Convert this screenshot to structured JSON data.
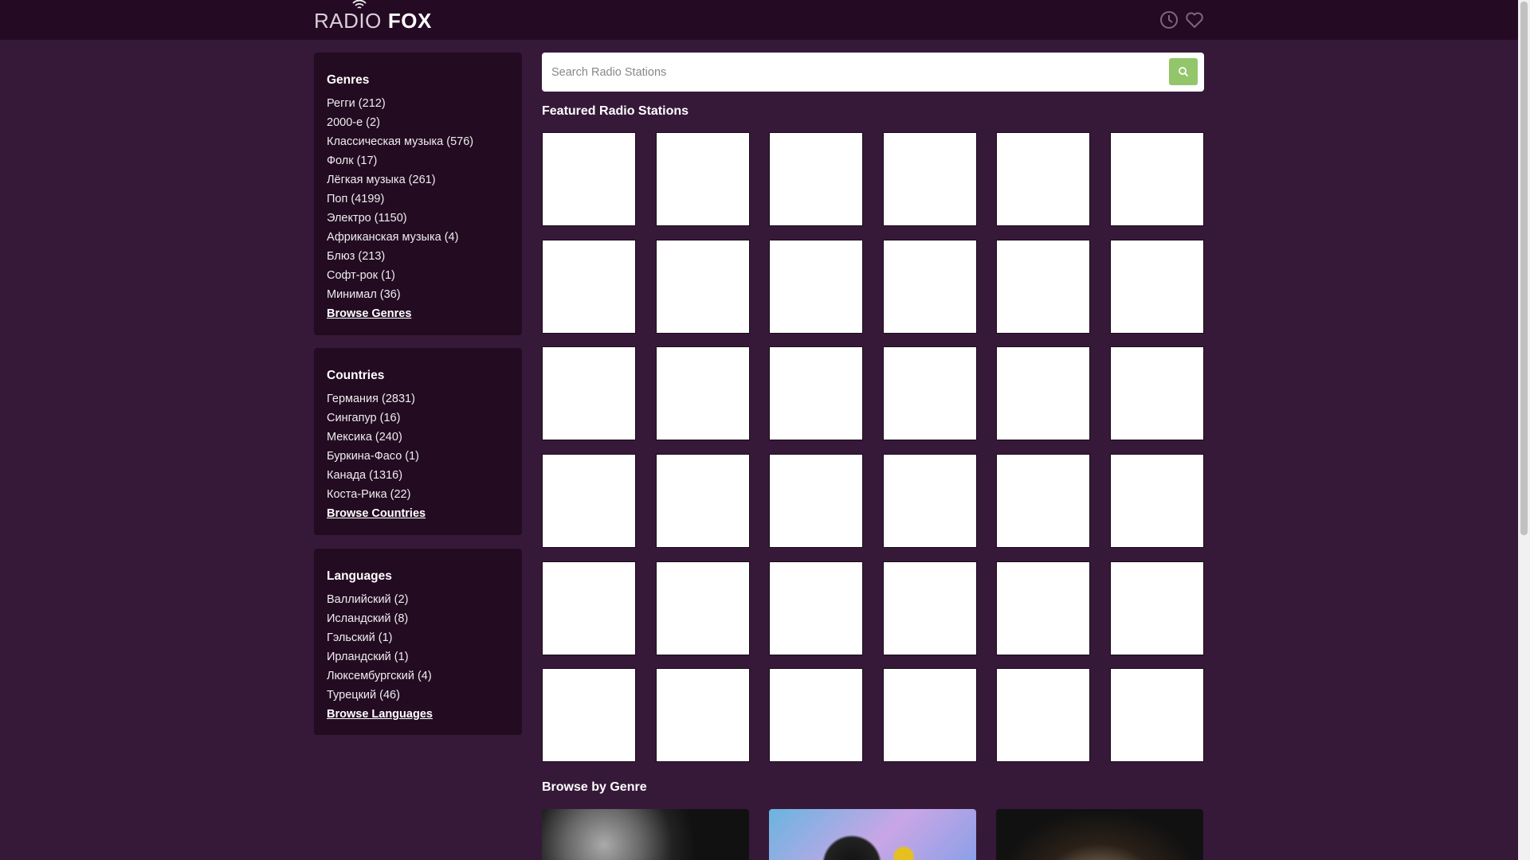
{
  "header": {
    "logo_light": "RADIO",
    "logo_bold": "FOX",
    "icons": [
      "history-clock-icon",
      "favorites-heart-icon"
    ]
  },
  "sidebar": {
    "genres": {
      "title": "Genres",
      "items": [
        "Регги (212)",
        "2000-е (2)",
        "Классическая музыка (576)",
        "Фолк (17)",
        "Лёгкая музыка (261)",
        "Поп (4199)",
        "Электро (1150)",
        "Африканская музыка (4)",
        "Блюз (213)",
        "Софт-рок (1)",
        "Минимал (36)"
      ],
      "browse": "Browse Genres"
    },
    "countries": {
      "title": "Countries",
      "items": [
        "Германия (2831)",
        "Сингапур (16)",
        "Мексика (240)",
        "Буркина-Фасо (1)",
        "Канада (1316)",
        "Коста-Рика (22)"
      ],
      "browse": "Browse Countries"
    },
    "languages": {
      "title": "Languages",
      "items": [
        "Валлийский (2)",
        "Исландский (8)",
        "Гэльский (1)",
        "Ирландский (1)",
        "Люксембургский (4)",
        "Турецкий (46)"
      ],
      "browse": "Browse Languages"
    }
  },
  "search": {
    "placeholder": "Search Radio Stations",
    "value": ""
  },
  "featured": {
    "title": "Featured Radio Stations",
    "tile_count": 36
  },
  "browse_by_genre": {
    "title": "Browse by Genre",
    "card_count": 3
  },
  "colors": {
    "header": "#250a24",
    "background": "#361938",
    "panel": "#230b22",
    "accent": "#93c66b"
  }
}
